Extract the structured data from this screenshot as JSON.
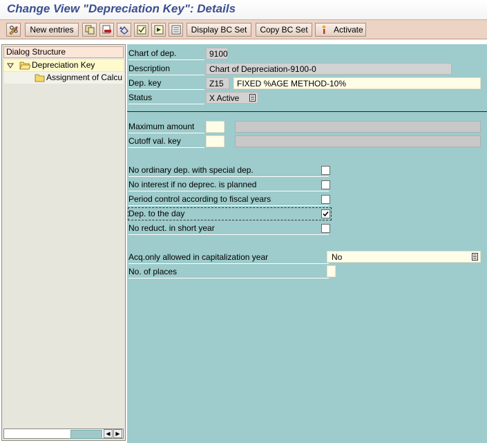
{
  "window": {
    "title": "Change View \"Depreciation Key\": Details"
  },
  "toolbar": {
    "new_entries": "New entries",
    "display_bc_set": "Display BC Set",
    "copy_bc_set": "Copy BC Set",
    "activate": "Activate"
  },
  "sidebar": {
    "header": "Dialog Structure",
    "items": [
      {
        "label": "Depreciation Key",
        "expanded": true,
        "selected": true
      },
      {
        "label": "Assignment of Calcu",
        "expanded": false,
        "selected": false
      }
    ]
  },
  "form": {
    "chart_of_dep": {
      "label": "Chart of dep.",
      "value": "9100"
    },
    "description": {
      "label": "Description",
      "value": "Chart of Depreciation-9100-0"
    },
    "dep_key": {
      "label": "Dep. key",
      "code": "Z15",
      "text": "FIXED %AGE METHOD-10%"
    },
    "status": {
      "label": "Status",
      "value": "X Active"
    },
    "maximum_amount": {
      "label": "Maximum amount",
      "value": "",
      "text": ""
    },
    "cutoff_val_key": {
      "label": "Cutoff val. key",
      "value": "",
      "text": ""
    },
    "checkboxes": [
      {
        "label": "No ordinary dep. with special dep.",
        "checked": false
      },
      {
        "label": "No interest if no deprec. is planned",
        "checked": false
      },
      {
        "label": "Period control according to fiscal years",
        "checked": false
      },
      {
        "label": "Dep. to the day",
        "checked": true
      },
      {
        "label": "No reduct. in short year",
        "checked": false
      }
    ],
    "acq_only": {
      "label": "Acq.only allowed in capitalization year",
      "value": "No"
    },
    "no_of_places": {
      "label": "No. of places",
      "value": ""
    }
  }
}
